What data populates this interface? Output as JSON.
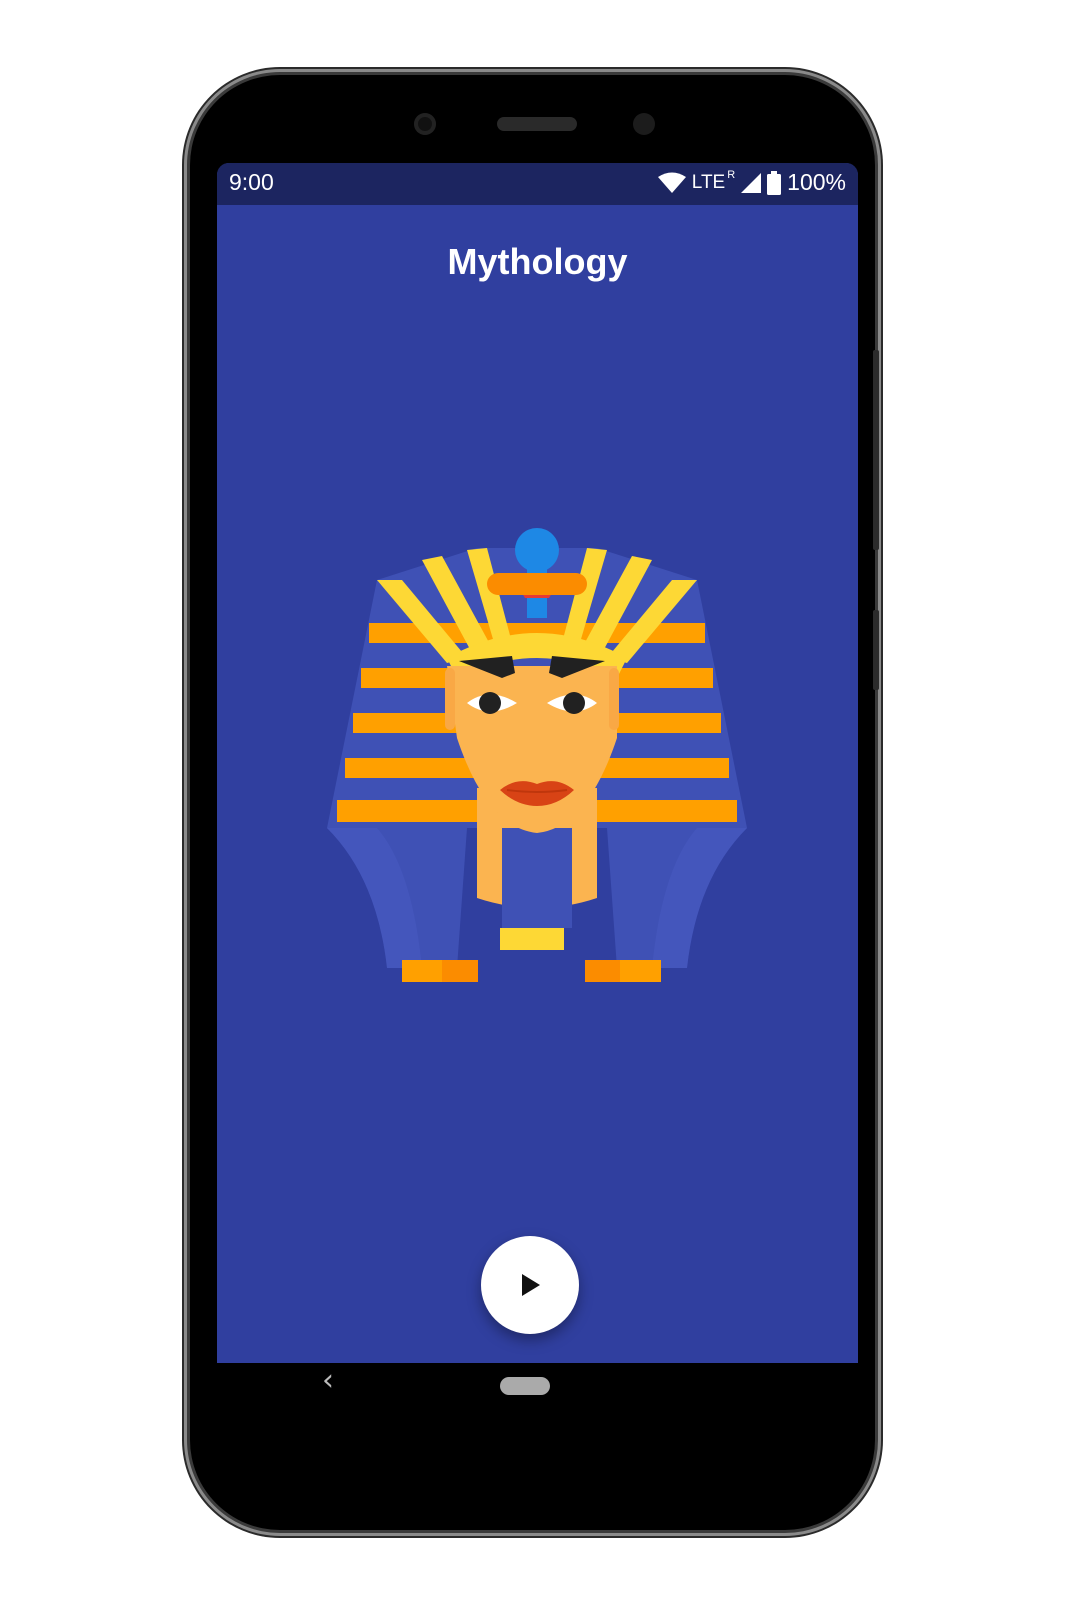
{
  "status_bar": {
    "time": "9:00",
    "network": "LTE",
    "roaming": "R",
    "battery": "100%",
    "icons": [
      "wifi-icon",
      "signal-icon",
      "battery-icon"
    ]
  },
  "app": {
    "title": "Mythology",
    "illustration": "pharaoh-mask-illustration",
    "fab_icon": "play-icon"
  },
  "nav_bar": {
    "back_icon": "back-chevron-icon",
    "home_icon": "home-pill-icon"
  },
  "colors": {
    "background": "#303f9f",
    "status_bar": "#1c2560",
    "fab": "#ffffff",
    "stripe_orange": "#ffa000",
    "stripe_yellow": "#fdd835",
    "face": "#fbb450",
    "lips": "#d84315"
  }
}
